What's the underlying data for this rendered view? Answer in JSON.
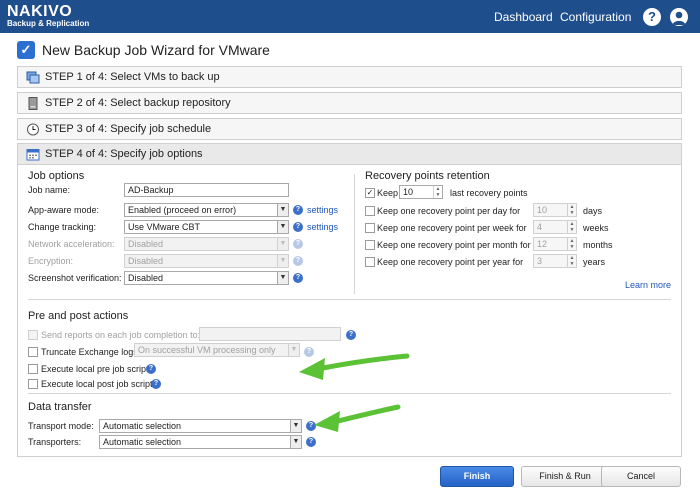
{
  "app": {
    "logo": "NAKIVO",
    "logo_sub": "Backup & Replication"
  },
  "nav": {
    "dashboard": "Dashboard",
    "configuration": "Configuration"
  },
  "icons": {
    "help": "?",
    "user": "user-icon"
  },
  "wizard": {
    "title": "New Backup Job Wizard for VMware"
  },
  "steps": [
    {
      "label": "STEP 1 of 4: Select VMs to back up"
    },
    {
      "label": "STEP 2 of 4: Select backup repository"
    },
    {
      "label": "STEP 3 of 4: Specify job schedule"
    },
    {
      "label": "STEP 4 of 4: Specify job options"
    }
  ],
  "job_options": {
    "title": "Job options",
    "job_name_label": "Job name:",
    "job_name_value": "AD-Backup",
    "app_aware_label": "App-aware mode:",
    "app_aware_value": "Enabled (proceed on error)",
    "change_tracking_label": "Change tracking:",
    "change_tracking_value": "Use VMware CBT",
    "network_accel_label": "Network acceleration:",
    "network_accel_value": "Disabled",
    "encryption_label": "Encryption:",
    "encryption_value": "Disabled",
    "screenshot_label": "Screenshot verification:",
    "screenshot_value": "Disabled",
    "settings_link": "settings"
  },
  "recovery": {
    "title": "Recovery points retention",
    "keep_label": "Keep",
    "keep_value": "10",
    "keep_suffix": "last recovery points",
    "rows": [
      {
        "label": "Keep one recovery point per day for",
        "value": "10",
        "unit": "days"
      },
      {
        "label": "Keep one recovery point per week for",
        "value": "4",
        "unit": "weeks"
      },
      {
        "label": "Keep one recovery point per month for",
        "value": "12",
        "unit": "months"
      },
      {
        "label": "Keep one recovery point per year for",
        "value": "3",
        "unit": "years"
      }
    ],
    "learn_more": "Learn more"
  },
  "pre_post": {
    "title": "Pre and post actions",
    "send_reports": "Send reports on each job completion to:",
    "truncate": "Truncate Exchange logs",
    "truncate_value": "On successful VM processing only",
    "pre_script": "Execute local pre job script",
    "post_script": "Execute local post job script"
  },
  "data_transfer": {
    "title": "Data transfer",
    "transport_label": "Transport mode:",
    "transport_value": "Automatic selection",
    "transporters_label": "Transporters:",
    "transporters_value": "Automatic selection"
  },
  "buttons": {
    "finish": "Finish",
    "finish_run": "Finish & Run",
    "cancel": "Cancel"
  },
  "colors": {
    "topbar": "#1f4e8c",
    "accent": "#2b6fd0",
    "arrow": "#5bc236",
    "link": "#2056b8"
  }
}
